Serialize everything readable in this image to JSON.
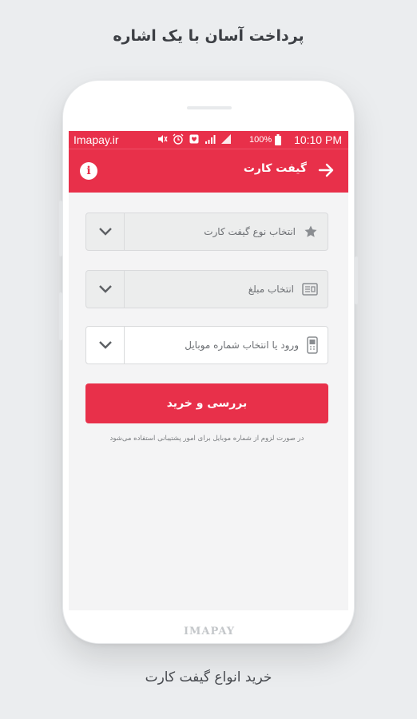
{
  "headline": "پرداخت آسان با یک اشاره",
  "footline": "خرید انواع گیفت کارت",
  "phone": {
    "brand_mark": "IMAPAY"
  },
  "statusbar": {
    "carrier": "Imapay.ir",
    "battery": "100%",
    "time": "10:10 PM"
  },
  "toolbar": {
    "title": "گیفت کارت",
    "info_glyph": "i"
  },
  "form": {
    "card_type": {
      "label": "انتخاب نوع گیفت کارت",
      "icon": "star-icon"
    },
    "amount": {
      "label": "انتخاب مبلغ",
      "icon": "bill-icon"
    },
    "mobile": {
      "label": "ورود یا انتخاب شماره موبایل",
      "icon": "mobile-phone-icon"
    },
    "submit_label": "بررسی و خرید",
    "note": "در صورت لزوم از شماره موبایل برای امور پشتیبانی استفاده می‌شود"
  },
  "colors": {
    "accent": "#e8304a",
    "background": "#ebedef"
  }
}
